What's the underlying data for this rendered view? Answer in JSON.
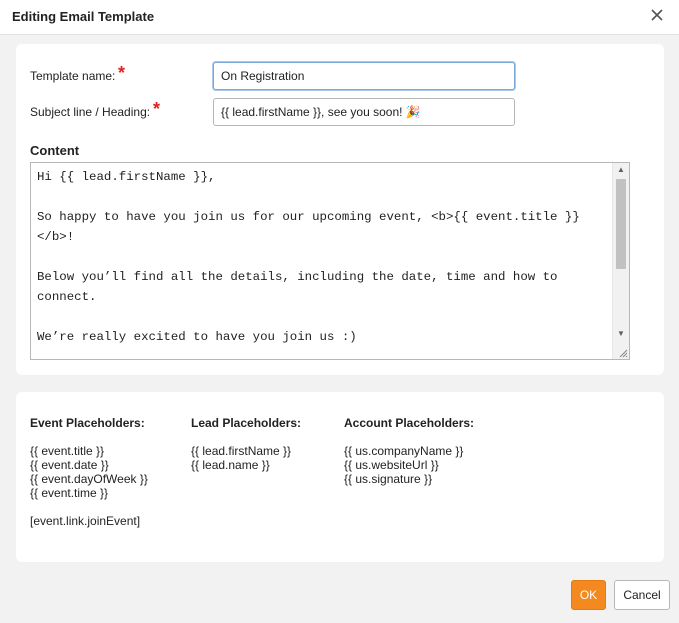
{
  "dialog": {
    "title": "Editing Email Template"
  },
  "form": {
    "template_name_label": "Template name:",
    "template_name_value": "On Registration",
    "subject_label": "Subject line / Heading:",
    "subject_value": "{{ lead.firstName }}, see you soon! 🎉",
    "required_mark": "*",
    "content_label": "Content",
    "content_value": "Hi {{ lead.firstName }},\n\nSo happy to have you join us for our upcoming event, <b>{{ event.title }}\n</b>!\n\nBelow you’ll find all the details, including the date, time and how to\nconnect.\n\nWe’re really excited to have you join us :)"
  },
  "placeholders": {
    "event": {
      "heading": "Event Placeholders:",
      "items": [
        "{{ event.title }}",
        "{{ event.date }}",
        "{{ event.dayOfWeek }}",
        "{{ event.time }}"
      ],
      "extra": "[event.link.joinEvent]"
    },
    "lead": {
      "heading": "Lead Placeholders:",
      "items": [
        "{{ lead.firstName }}",
        "{{ lead.name }}"
      ]
    },
    "account": {
      "heading": "Account Placeholders:",
      "items": [
        "{{ us.companyName }}",
        "{{ us.websiteUrl }}",
        "{{ us.signature }}"
      ]
    }
  },
  "buttons": {
    "ok": "OK",
    "cancel": "Cancel"
  },
  "icons": {
    "close": "close-icon",
    "scroll_up": "chevron-up-icon",
    "scroll_down": "chevron-down-icon",
    "resize": "resize-grip-icon"
  },
  "colors": {
    "accent": "#f48a1f",
    "required": "#e02020",
    "focus_border": "#7aa8d8"
  }
}
